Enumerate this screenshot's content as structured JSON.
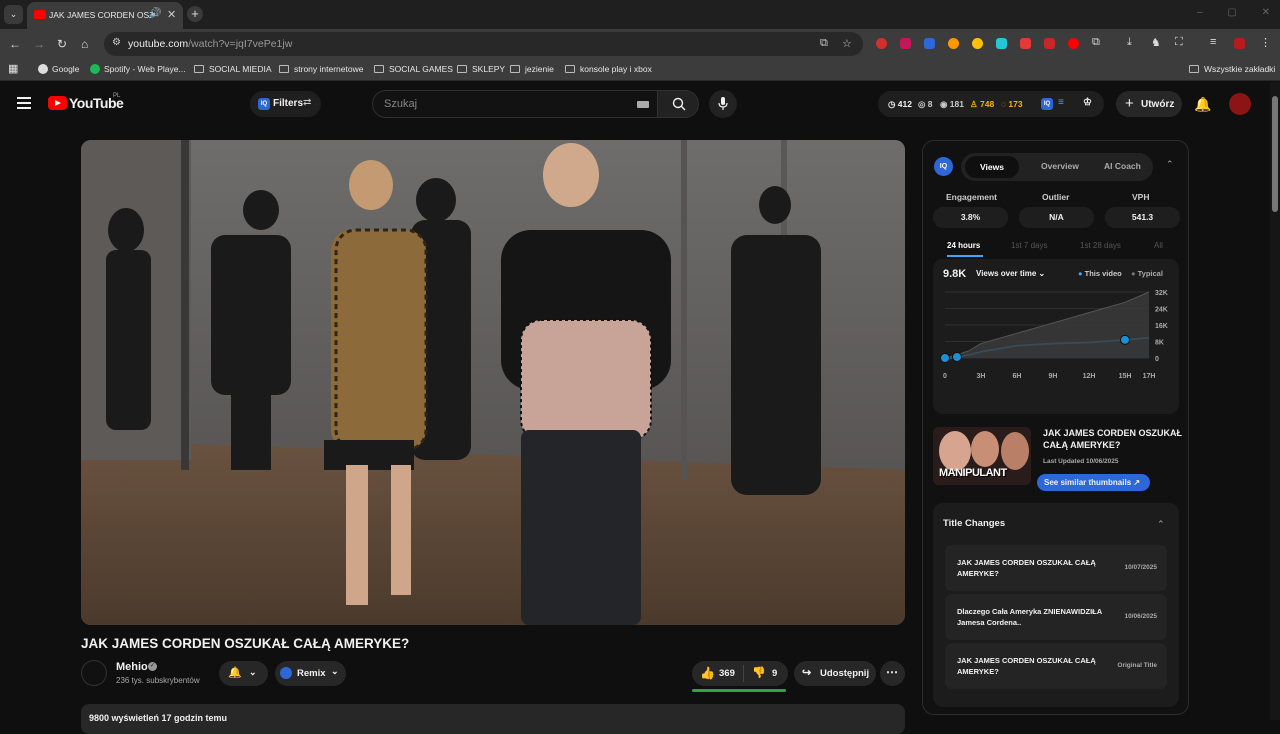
{
  "browser": {
    "tab_title": "JAK JAMES CORDEN OSZUK",
    "url_domain": "youtube.com",
    "url_path": "/watch?v=jqI7vePe1jw",
    "bookmarks": [
      "Google",
      "Spotify - Web Playe...",
      "SOCIAL MIEDIA",
      "strony internetowe",
      "SOCIAL GAMES",
      "SKLEPY",
      "jezienie",
      "konsole play i xbox"
    ],
    "all_bookmarks": "Wszystkie zakładki"
  },
  "header": {
    "logo_text": "YouTube",
    "country_code": "PL",
    "filters_label": "Filters",
    "iq_label": "IQ",
    "search_placeholder": "Szukaj",
    "stats": {
      "a": "412",
      "b": "8",
      "c": "181",
      "d": "748",
      "e": "173"
    },
    "create_label": "Utwórz"
  },
  "video": {
    "title": "JAK JAMES CORDEN OSZUKAŁ CAŁĄ AMERYKE?",
    "channel": "Mehio",
    "subscribers": "236 tys. subskrybentów",
    "remix_label": "Remix",
    "likes": "369",
    "dislikes": "9",
    "share_label": "Udostępnij",
    "desc_meta": "9800 wyświetleń  17 godzin temu"
  },
  "panel": {
    "iq_label": "IQ",
    "tabs": [
      "Views",
      "Overview",
      "AI Coach"
    ],
    "metrics": [
      {
        "label": "Engagement",
        "value": "3.8%"
      },
      {
        "label": "Outlier",
        "value": "N/A"
      },
      {
        "label": "VPH",
        "value": "541.3"
      }
    ],
    "ranges": [
      "24 hours",
      "1st 7 days",
      "1st 28 days",
      "All"
    ],
    "chart_total": "9.8K",
    "chart_dropdown": "Views over time",
    "legend_this": "This video",
    "legend_typical": "Typical",
    "thumb_title": "JAK JAMES CORDEN OSZUKAŁ CAŁĄ AMERYKE?",
    "thumb_updated": "Last Updated 10/06/2025",
    "thumb_text": "MANIPULANT",
    "see_similar": "See similar thumbnails",
    "title_changes_heading": "Title Changes",
    "title_changes": [
      {
        "title": "JAK JAMES CORDEN OSZUKAŁ CAŁĄ AMERYKE?",
        "date": "10/07/2025"
      },
      {
        "title": "Dlaczego Cała Ameryka ZNIENAWIDZIŁA Jamesa Cordena..",
        "date": "10/06/2025"
      },
      {
        "title": "JAK JAMES CORDEN OSZUKAŁ CAŁĄ AMERYKE?",
        "date": "Original Title"
      }
    ]
  },
  "chart_data": {
    "type": "area",
    "x_tick_labels": [
      "0",
      "3H",
      "6H",
      "9H",
      "12H",
      "15H",
      "17H"
    ],
    "y_tick_labels": [
      "32K",
      "24K",
      "16K",
      "8K",
      "0"
    ],
    "ylim": [
      0,
      32000
    ],
    "x_hours": [
      0,
      1,
      2,
      3,
      6,
      9,
      12,
      15,
      17
    ],
    "series": [
      {
        "name": "This video",
        "color": "#3ea6ff",
        "values": [
          0,
          500,
          1500,
          3000,
          6000,
          7000,
          7500,
          8800,
          9800
        ]
      },
      {
        "name": "Typical",
        "color": "#555555",
        "values": [
          0,
          1500,
          3500,
          7000,
          12000,
          17000,
          22000,
          27000,
          32000
        ]
      }
    ],
    "markers_at_hours": [
      0,
      1,
      15
    ]
  },
  "colors": {
    "accent_blue": "#3ea6ff",
    "iq_blue": "#2e67d8",
    "yt_red": "#ff0000",
    "like_bar": "#2ba640"
  }
}
